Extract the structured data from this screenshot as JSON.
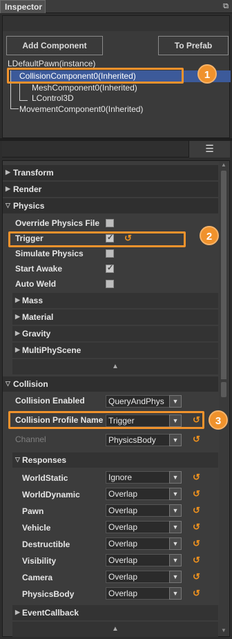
{
  "window": {
    "title": "Inspector",
    "dock_icon": "dock-icon"
  },
  "toolbar": {
    "add_component": "Add Component",
    "to_prefab": "To Prefab",
    "menu_icon": "list-icon"
  },
  "tree": [
    {
      "label": "LDefaultPawn(instance)"
    },
    {
      "label": "CollisionComponent0(Inherited)",
      "selected": true
    },
    {
      "label": "MeshComponent0(Inherited)"
    },
    {
      "label": "LControl3D"
    },
    {
      "label": "MovementComponent0(Inherited)"
    }
  ],
  "sections": {
    "transform": "Transform",
    "render": "Render",
    "physics": "Physics",
    "collision": "Collision"
  },
  "physics": {
    "override_physics_file": {
      "label": "Override Physics File",
      "checked": false
    },
    "trigger": {
      "label": "Trigger",
      "checked": true
    },
    "simulate_physics": {
      "label": "Simulate Physics",
      "checked": false
    },
    "start_awake": {
      "label": "Start Awake",
      "checked": true
    },
    "auto_weld": {
      "label": "Auto Weld",
      "checked": false
    },
    "sub": {
      "mass": "Mass",
      "material": "Material",
      "gravity": "Gravity",
      "multiphyscene": "MultiPhyScene"
    }
  },
  "collision": {
    "enabled": {
      "label": "Collision Enabled",
      "value": "QueryAndPhys"
    },
    "profile": {
      "label": "Collision Profile Name",
      "value": "Trigger"
    },
    "channel": {
      "label": "Channel",
      "value": "PhysicsBody"
    },
    "responses_title": "Responses",
    "responses": [
      {
        "label": "WorldStatic",
        "value": "Ignore"
      },
      {
        "label": "WorldDynamic",
        "value": "Overlap"
      },
      {
        "label": "Pawn",
        "value": "Overlap"
      },
      {
        "label": "Vehicle",
        "value": "Overlap"
      },
      {
        "label": "Destructible",
        "value": "Overlap"
      },
      {
        "label": "Visibility",
        "value": "Overlap"
      },
      {
        "label": "Camera",
        "value": "Overlap"
      },
      {
        "label": "PhysicsBody",
        "value": "Overlap"
      }
    ],
    "event_callback": "EventCallback"
  },
  "callouts": [
    "1",
    "2",
    "3"
  ],
  "colors": {
    "accent": "#f0922c",
    "selection": "#3c5a9a",
    "reset": "#f0921e"
  }
}
